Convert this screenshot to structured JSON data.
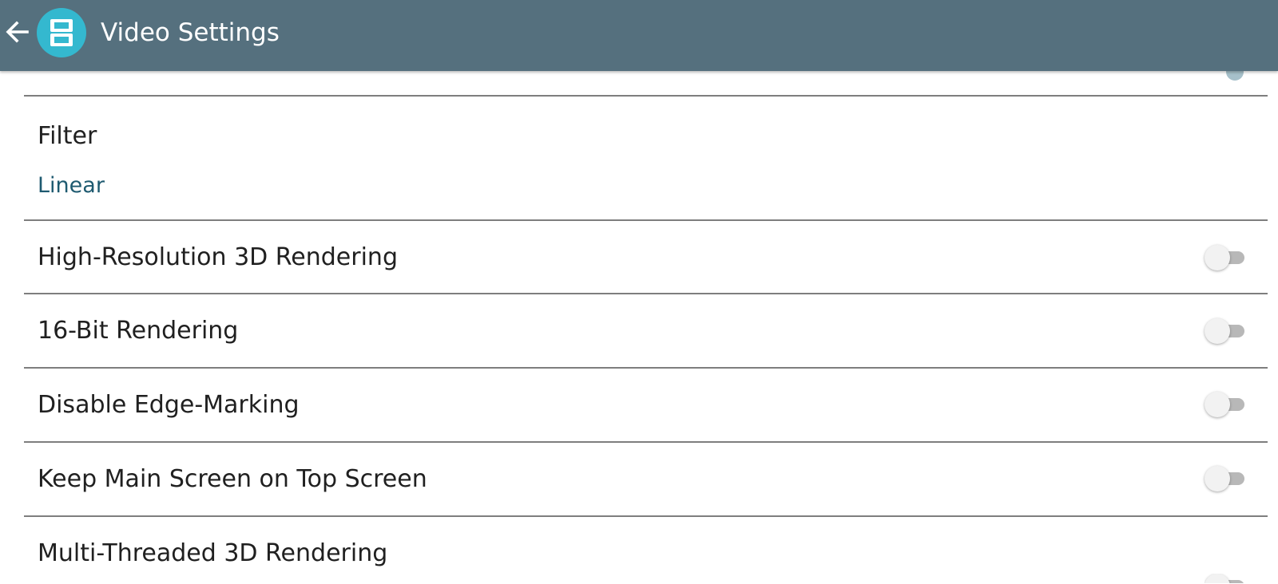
{
  "app_bar": {
    "title": "Video Settings",
    "back_icon": "arrow-left-icon",
    "logo_icon": "nintendo-ds-icon",
    "background_color": "#55707e",
    "logo_color": "#34b8cf"
  },
  "settings": {
    "filter": {
      "label": "Filter",
      "value": "Linear"
    },
    "high_res_3d": {
      "label": "High-Resolution 3D Rendering",
      "enabled": false
    },
    "bit16": {
      "label": "16-Bit Rendering",
      "enabled": false
    },
    "disable_edge": {
      "label": "Disable Edge-Marking",
      "enabled": false
    },
    "keep_main": {
      "label": "Keep Main Screen on Top Screen",
      "enabled": false
    },
    "multi_threaded": {
      "label": "Multi-Threaded 3D Rendering",
      "enabled": false
    }
  },
  "colors": {
    "value_text": "#1e5a70",
    "divider": "#7e7e7e",
    "switch_track_off": "#b8b8b8",
    "switch_thumb_off": "#f2f2f2"
  }
}
